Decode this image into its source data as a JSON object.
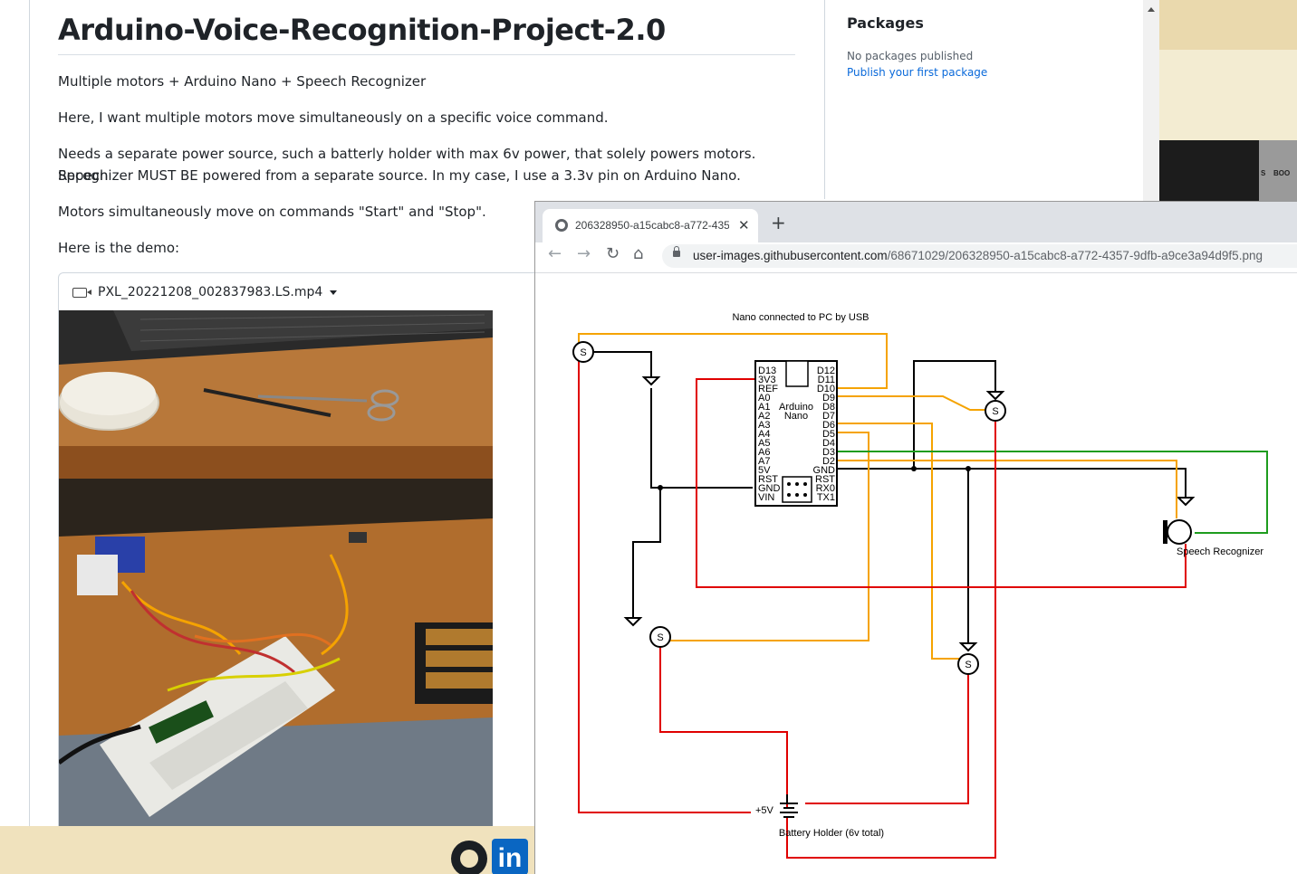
{
  "readme": {
    "title": "Arduino-Voice-Recognition-Project-2.0",
    "p1": "Multiple motors + Arduino Nano + Speech Recognizer",
    "p2": "Here, I want multiple motors move simultaneously on a specific voice command.",
    "p3a": "Needs a separate power source, such a batterly holder with max 6v power, that solely powers motors. Sppech",
    "p3b": "Recognizer MUST BE powered from a separate source. In my case, I use a 3.3v pin on Arduino Nano.",
    "p4": "Motors simultaneously move on commands \"Start\" and \"Stop\".",
    "p5": "Here is the demo:",
    "video_file": "PXL_20221208_002837983.LS.mp4"
  },
  "sidebar": {
    "packages_heading": "Packages",
    "packages_none": "No packages published",
    "packages_link": "Publish your first package"
  },
  "viewer": {
    "tab_title": "206328950-a15cabc8-a772-4357",
    "url_domain": "user-images.githubusercontent.com",
    "url_path": "/68671029/206328950-a15cabc8-a772-4357-9dfb-a9ce3a94d9f5.png"
  },
  "schematic": {
    "top_label": "Nano connected to PC by USB",
    "board_label_1": "Arduino",
    "board_label_2": "Nano",
    "left_pins": [
      "D13",
      "3V3",
      "REF",
      "A0",
      "A1",
      "A2",
      "A3",
      "A4",
      "A5",
      "A6",
      "A7",
      "5V",
      "RST",
      "GND",
      "VIN"
    ],
    "right_pins": [
      "D12",
      "D11",
      "D10",
      "D9",
      "D8",
      "D7",
      "D6",
      "D5",
      "D4",
      "D3",
      "D2",
      "GND",
      "RST",
      "RX0",
      "TX1"
    ],
    "servo_label": "S",
    "speech_label": "Speech Recognizer",
    "battery_label": "Battery Holder (6v total)",
    "battery_voltage": "+5V",
    "colors": {
      "signal": "#f5a300",
      "power": "#e00000",
      "ground": "#000000",
      "data": "#1e9c1e"
    }
  },
  "desktop": {
    "photo_label_1": "S",
    "photo_label_2": "BOO",
    "corner_char": "s"
  }
}
